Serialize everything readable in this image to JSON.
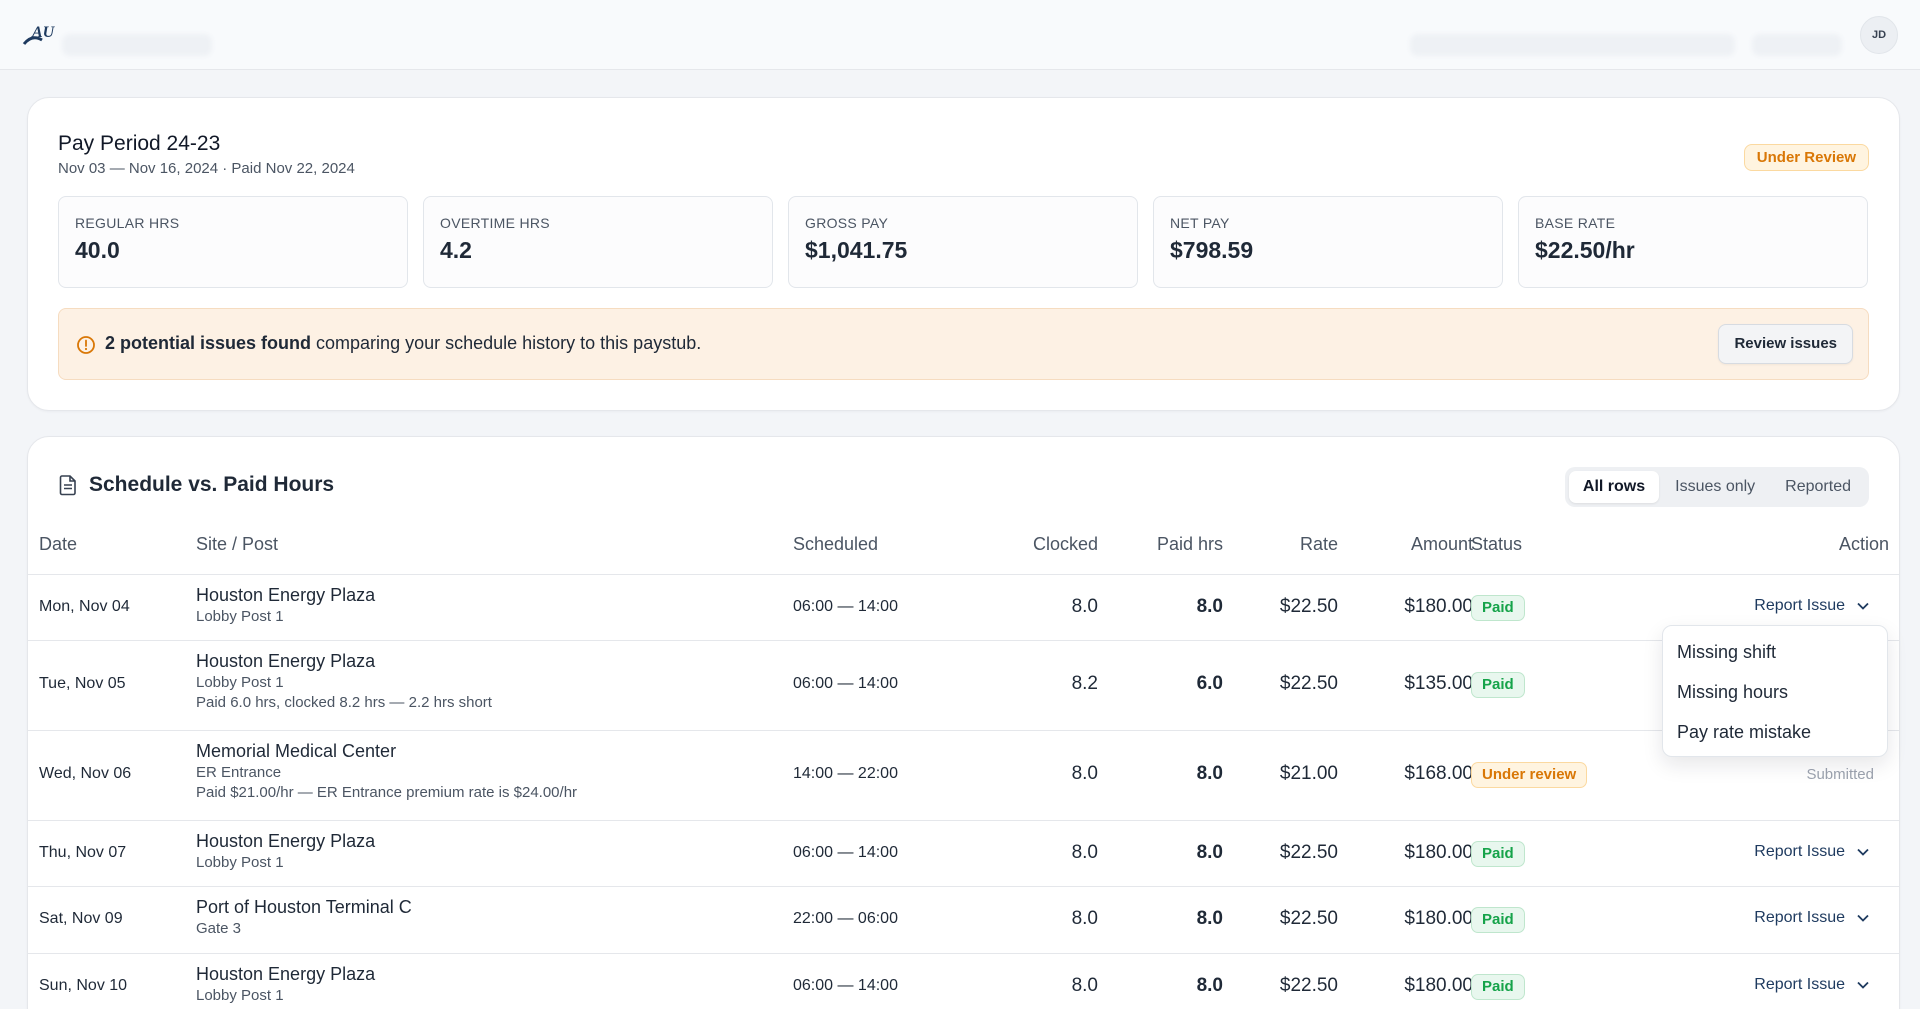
{
  "header": {
    "logo_text": "AU",
    "avatar_initials": "JD"
  },
  "summary": {
    "title": "Pay Period 24-23",
    "subtitle": "Nov 03 — Nov 16, 2024 · Paid Nov 22, 2024",
    "status_badge": "Under Review",
    "stats": [
      {
        "label": "REGULAR HRS",
        "value": "40.0"
      },
      {
        "label": "OVERTIME HRS",
        "value": "4.2"
      },
      {
        "label": "GROSS PAY",
        "value": "$1,041.75"
      },
      {
        "label": "NET PAY",
        "value": "$798.59"
      },
      {
        "label": "BASE RATE",
        "value": "$22.50/hr"
      }
    ],
    "alert": {
      "bold": "2 potential issues found",
      "rest": " comparing your schedule history to this paystub.",
      "button": "Review issues"
    }
  },
  "schedule": {
    "title": "Schedule vs. Paid Hours",
    "filters": [
      "All rows",
      "Issues only",
      "Reported"
    ],
    "columns": {
      "date": "Date",
      "site": "Site / Post",
      "scheduled": "Scheduled",
      "clocked": "Clocked",
      "paid": "Paid hrs",
      "rate": "Rate",
      "amount": "Amount",
      "status": "Status",
      "action": "Action"
    },
    "rows": [
      {
        "date": "Mon, Nov 04",
        "site": "Houston Energy Plaza",
        "post": "Lobby Post 1",
        "note": "",
        "scheduled": "06:00 — 14:00",
        "clocked": "8.0",
        "paid": "8.0",
        "rate": "$22.50",
        "amount": "$180.00",
        "status": "Paid",
        "action": "Report Issue"
      },
      {
        "date": "Tue, Nov 05",
        "site": "Houston Energy Plaza",
        "post": "Lobby Post 1",
        "note": "Paid 6.0 hrs, clocked 8.2 hrs — 2.2 hrs short",
        "scheduled": "06:00 — 14:00",
        "clocked": "8.2",
        "paid": "6.0",
        "rate": "$22.50",
        "amount": "$135.00",
        "status": "Paid",
        "action": ""
      },
      {
        "date": "Wed, Nov 06",
        "site": "Memorial Medical Center",
        "post": "ER Entrance",
        "note": "Paid $21.00/hr — ER Entrance premium rate is $24.00/hr",
        "scheduled": "14:00 — 22:00",
        "clocked": "8.0",
        "paid": "8.0",
        "rate": "$21.00",
        "amount": "$168.00",
        "status": "Under review",
        "action": "Submitted"
      },
      {
        "date": "Thu, Nov 07",
        "site": "Houston Energy Plaza",
        "post": "Lobby Post 1",
        "note": "",
        "scheduled": "06:00 — 14:00",
        "clocked": "8.0",
        "paid": "8.0",
        "rate": "$22.50",
        "amount": "$180.00",
        "status": "Paid",
        "action": "Report Issue"
      },
      {
        "date": "Sat, Nov 09",
        "site": "Port of Houston Terminal C",
        "post": "Gate 3",
        "note": "",
        "scheduled": "22:00 — 06:00",
        "clocked": "8.0",
        "paid": "8.0",
        "rate": "$22.50",
        "amount": "$180.00",
        "status": "Paid",
        "action": "Report Issue"
      },
      {
        "date": "Sun, Nov 10",
        "site": "Houston Energy Plaza",
        "post": "Lobby Post 1",
        "note": "",
        "scheduled": "06:00 — 14:00",
        "clocked": "8.0",
        "paid": "8.0",
        "rate": "$22.50",
        "amount": "$180.00",
        "status": "Paid",
        "action": "Report Issue"
      }
    ]
  },
  "dropdown": {
    "items": [
      "Missing shift",
      "Missing hours",
      "Pay rate mistake"
    ]
  },
  "colors": {
    "accent_navy": "#1e3a5f",
    "paid_green": "#16a34a",
    "review_orange": "#d97706",
    "alert_bg": "#fdf1e4"
  }
}
